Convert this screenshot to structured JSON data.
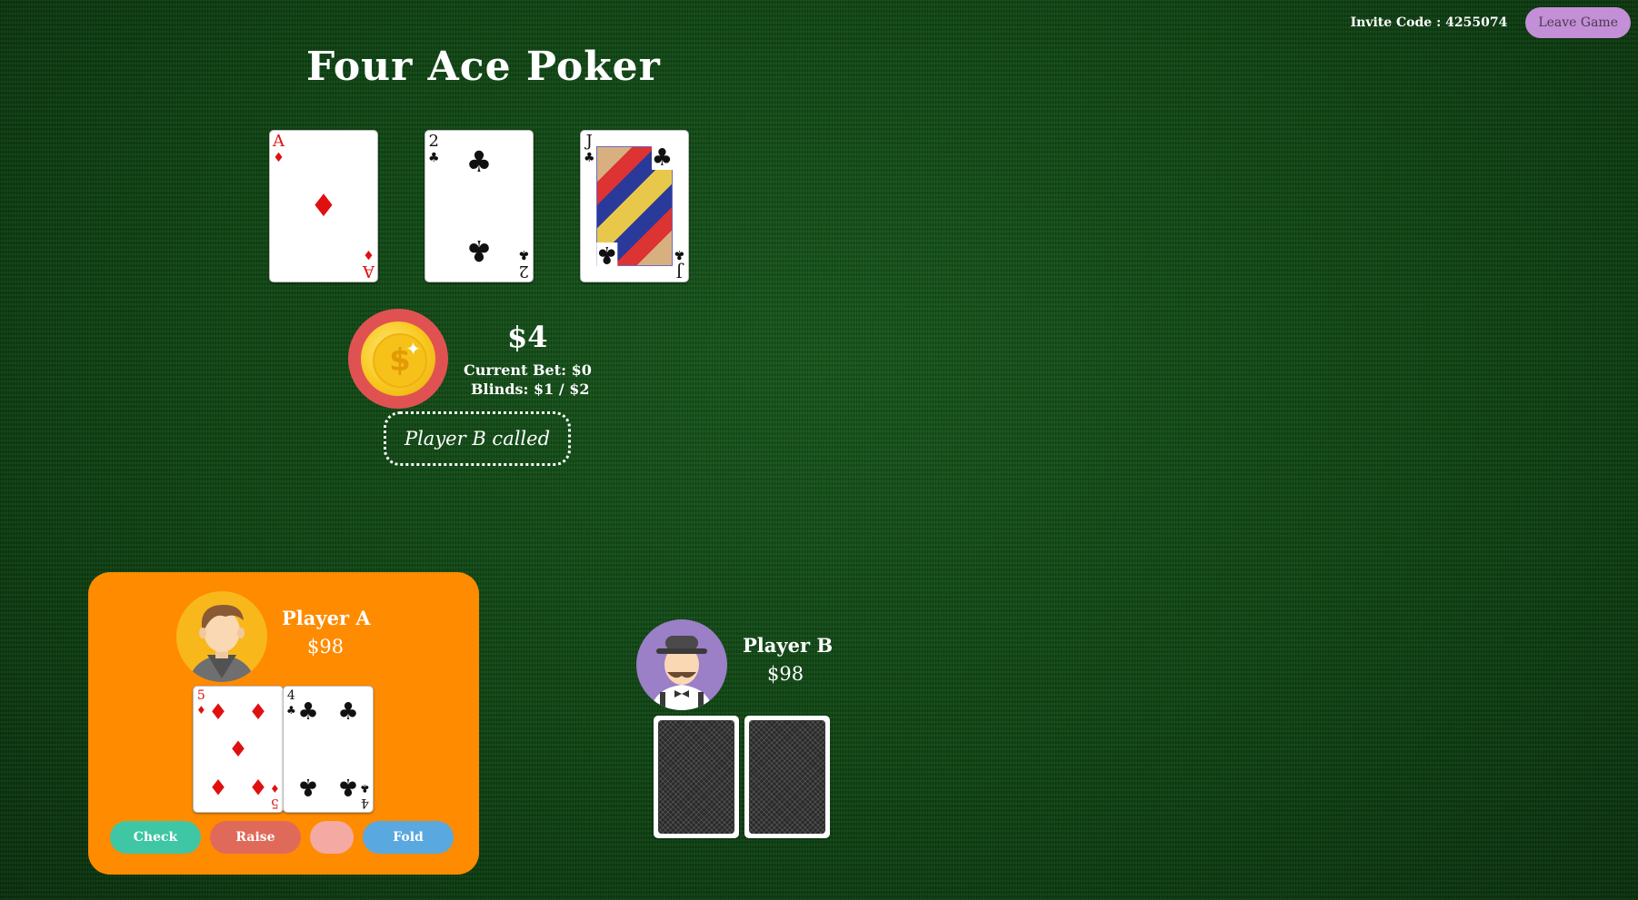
{
  "header": {
    "invite_label": "Invite Code : 4255074",
    "leave_label": "Leave Game"
  },
  "game": {
    "title": "Four Ace Poker"
  },
  "board": {
    "cards": [
      {
        "rank": "A",
        "suit": "♦",
        "color": "#e01010"
      },
      {
        "rank": "2",
        "suit": "♣",
        "color": "#111111"
      },
      {
        "rank": "J",
        "suit": "♣",
        "color": "#111111"
      }
    ]
  },
  "pot": {
    "amount": "$4",
    "current_bet": "Current Bet: $0",
    "blinds": "Blinds: $1 / $2",
    "chip_symbol": "$",
    "icon": "coin-icon"
  },
  "status": {
    "message": "Player B called"
  },
  "player_a": {
    "name": "Player A",
    "chips": "$98",
    "avatar": "young-man-avatar",
    "cards": [
      {
        "rank": "5",
        "suit": "♦",
        "color": "#e01010"
      },
      {
        "rank": "4",
        "suit": "♣",
        "color": "#111111"
      }
    ],
    "actions": {
      "check_label": "Check",
      "raise_label": "Raise",
      "raise_amount": "",
      "fold_label": "Fold"
    }
  },
  "player_b": {
    "name": "Player B",
    "chips": "$98",
    "avatar": "gentleman-bowler-hat-avatar",
    "cards_face_down": 2
  },
  "colors": {
    "table": "#124816",
    "panel": "#ff8b00",
    "check": "#3fc6a4",
    "raise": "#e06a5a",
    "fold": "#5aa8e0",
    "leave": "#c38fd6"
  }
}
